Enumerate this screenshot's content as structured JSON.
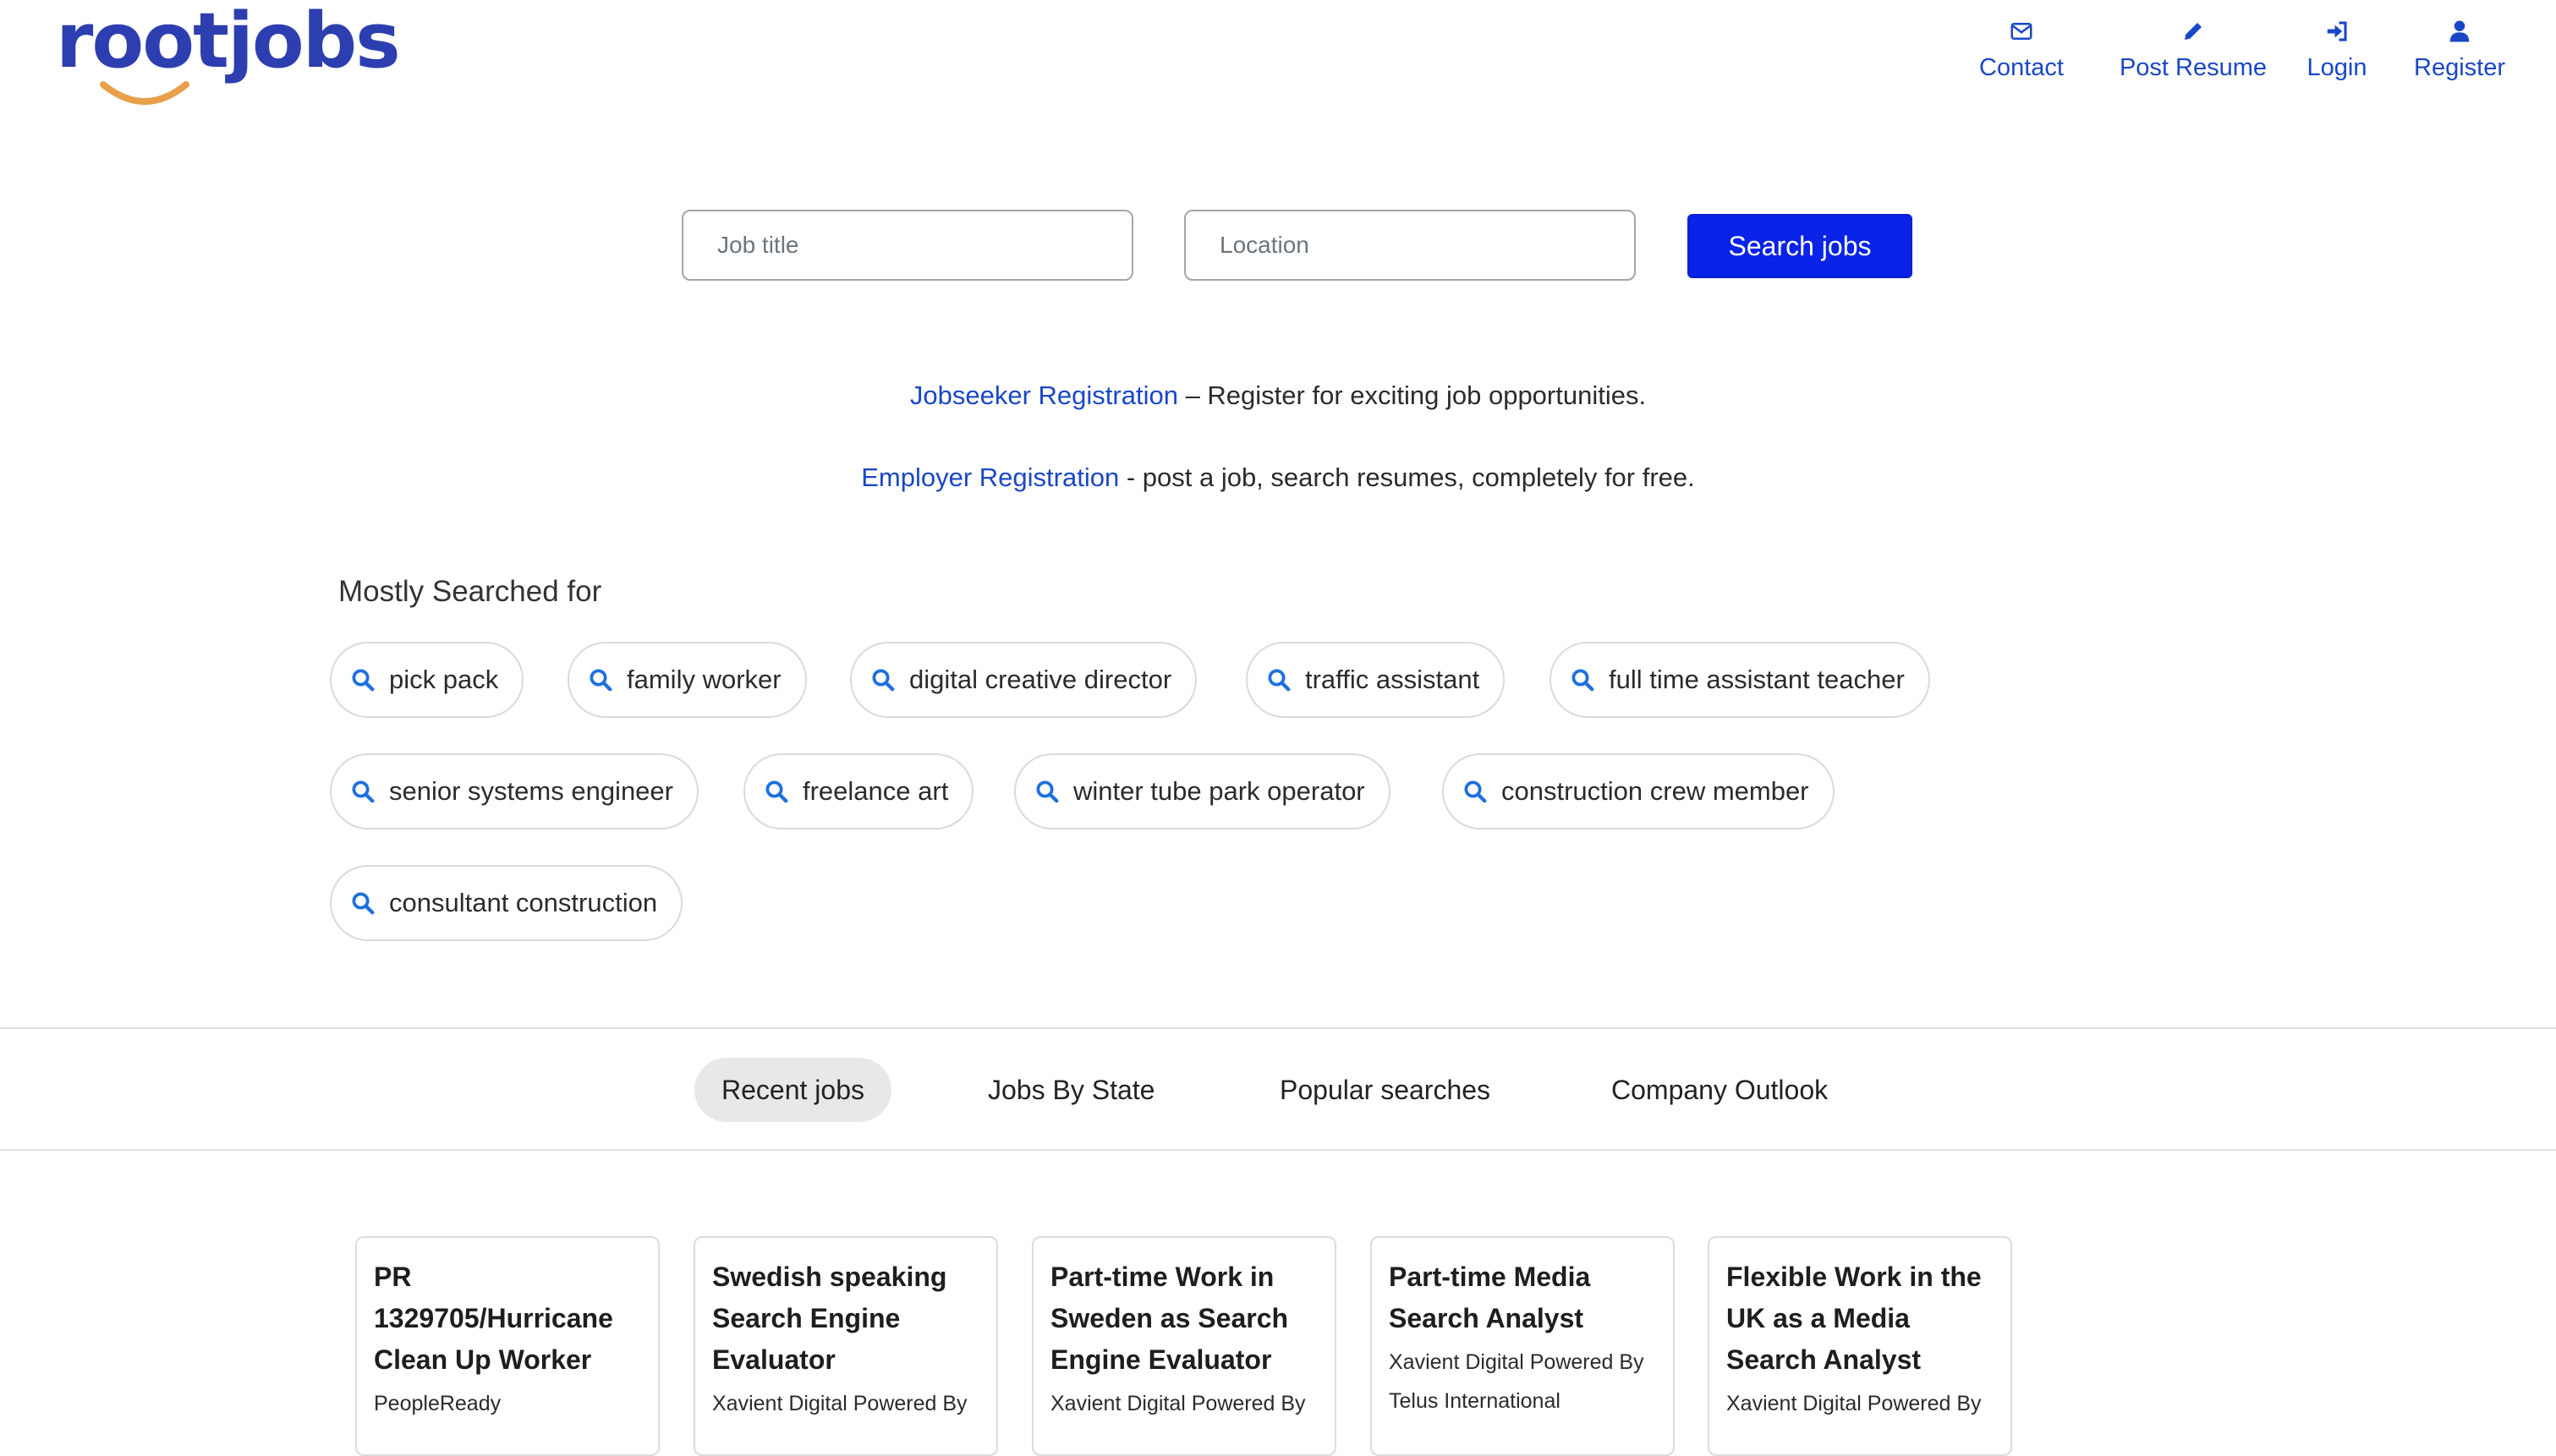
{
  "brand": {
    "logo_text": "rootjobs"
  },
  "nav": {
    "contact": "Contact",
    "post_resume": "Post Resume",
    "login": "Login",
    "register": "Register"
  },
  "search": {
    "job_title_placeholder": "Job title",
    "location_placeholder": "Location",
    "button_label": "Search jobs"
  },
  "registration": {
    "jobseeker_link": "Jobseeker Registration",
    "jobseeker_text": " – Register for exciting job opportunities.",
    "employer_link": "Employer Registration",
    "employer_text": " - post a job, search resumes, completely for free."
  },
  "mostly_searched": {
    "title": "Mostly Searched for",
    "items": [
      "pick pack",
      "family worker",
      "digital creative director",
      "traffic assistant",
      "full time assistant teacher",
      "senior systems engineer",
      "freelance art",
      "winter tube park operator",
      "construction crew member",
      "consultant construction"
    ]
  },
  "tabs": [
    "Recent jobs",
    "Jobs By State",
    "Popular searches",
    "Company Outlook"
  ],
  "active_tab": "Recent jobs",
  "jobs": [
    {
      "title_lines": [
        "PR",
        "1329705/Hurricane",
        "Clean Up Worker"
      ],
      "company_lines": [
        "PeopleReady"
      ]
    },
    {
      "title_lines": [
        "Swedish speaking",
        "Search Engine",
        "Evaluator"
      ],
      "company_lines": [
        "Xavient Digital Powered By"
      ]
    },
    {
      "title_lines": [
        "Part-time Work in",
        "Sweden as Search",
        "Engine Evaluator"
      ],
      "company_lines": [
        "Xavient Digital Powered By"
      ]
    },
    {
      "title_lines": [
        "Part-time Media",
        "Search Analyst"
      ],
      "company_lines": [
        "Xavient Digital Powered By",
        "Telus International"
      ]
    },
    {
      "title_lines": [
        "Flexible Work in the",
        "UK as a Media",
        "Search Analyst"
      ],
      "company_lines": [
        "Xavient Digital Powered By"
      ]
    }
  ],
  "colors": {
    "brand_blue": "#2d3eb0",
    "smile_orange": "#e8a04b",
    "link_blue": "#1a47c7",
    "search_icon_blue": "#1e6fe0",
    "button_blue": "#0a23e8",
    "active_tab_bg": "#e8e8e8"
  }
}
